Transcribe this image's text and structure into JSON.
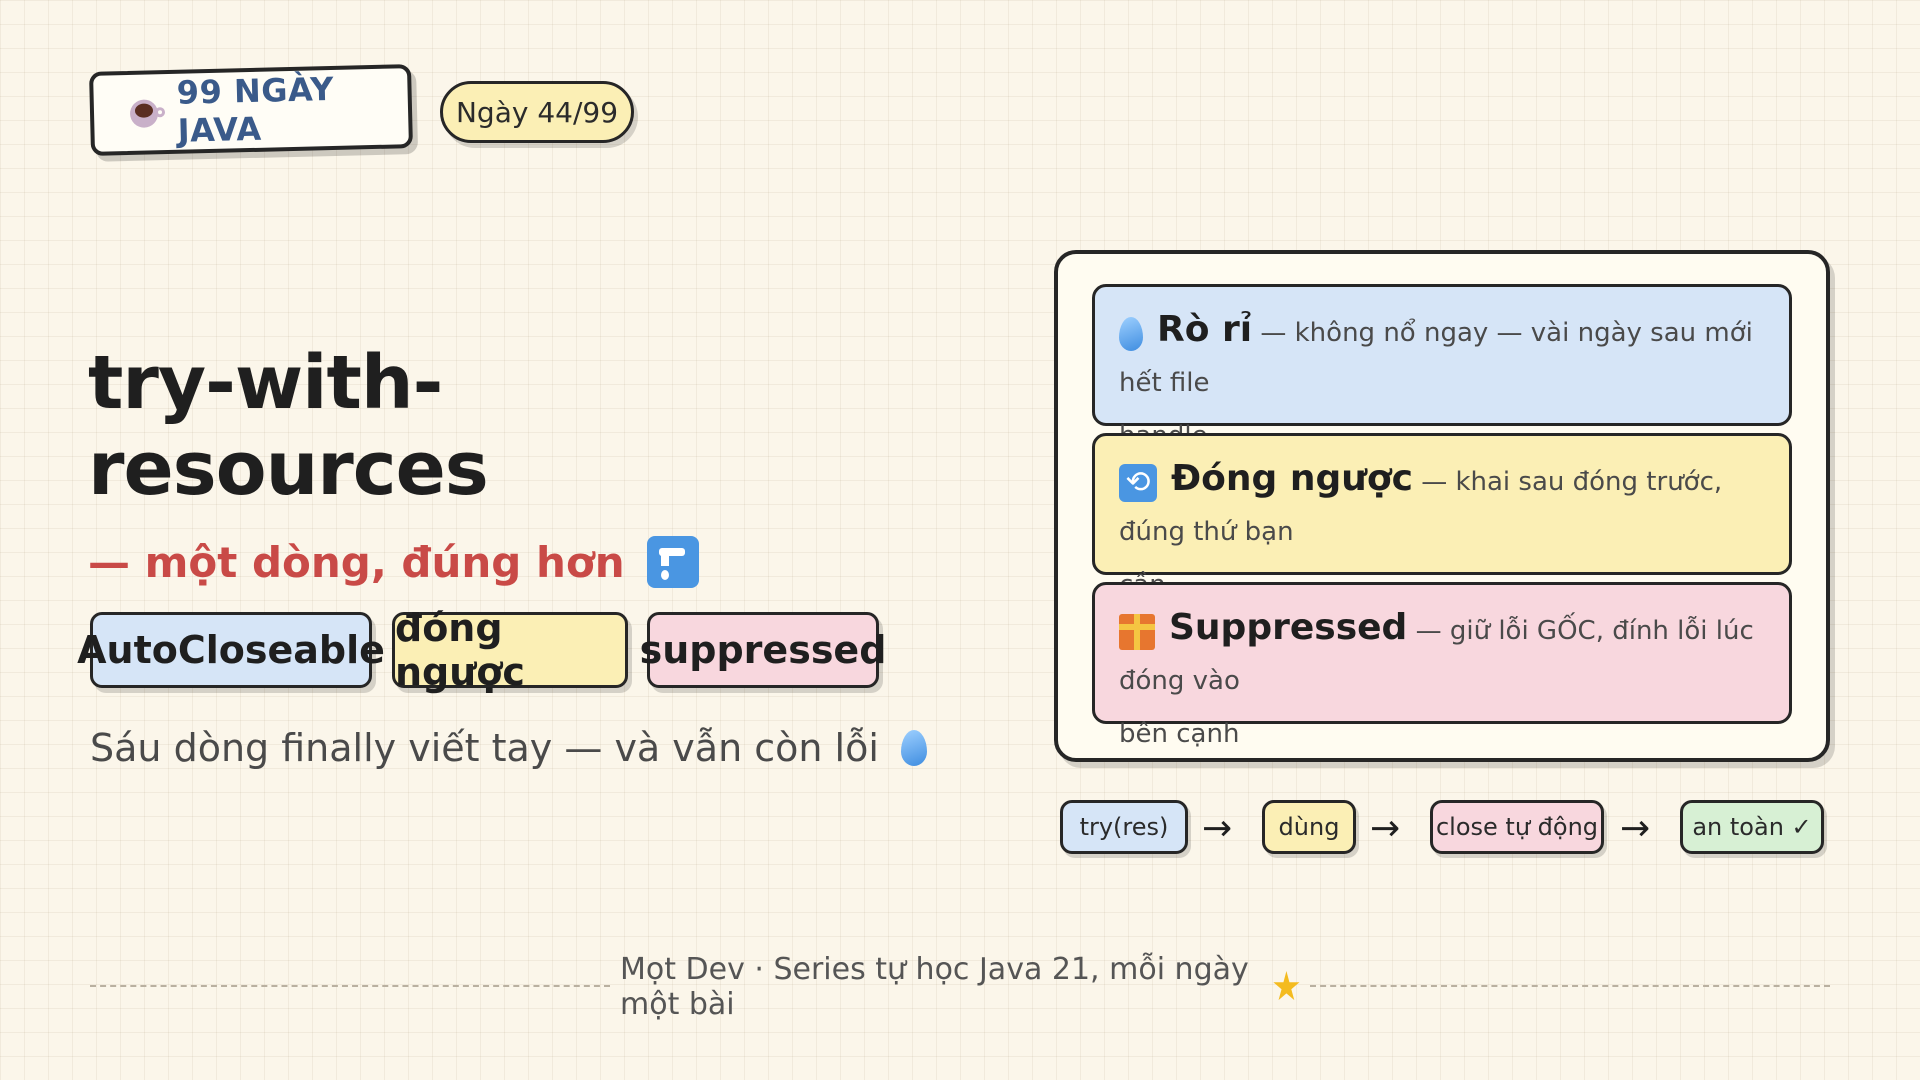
{
  "header": {
    "series_label": "99 NGÀY JAVA",
    "day_label": "Ngày 44/99"
  },
  "hero": {
    "title_line1": "try-with-",
    "title_line2": "resources",
    "subtitle": "— một dòng, đúng hơn",
    "tags": [
      "AutoCloseable",
      "đóng ngược",
      "suppressed"
    ],
    "tagline": "Sáu dòng finally viết tay — và vẫn còn lỗi"
  },
  "cards": [
    {
      "icon": "droplet-icon",
      "head": "Rò rỉ",
      "text": "— không nổ ngay — vài ngày sau mới hết file",
      "text2": "handle",
      "color": "#d6e5f7"
    },
    {
      "icon": "reverse-arrows-icon",
      "head": "Đóng ngược",
      "text": "— khai sau đóng trước, đúng thứ bạn",
      "text2": "cần",
      "color": "#fbefb5"
    },
    {
      "icon": "gift-icon",
      "head": "Suppressed",
      "text": "— giữ lỗi GỐC, đính lỗi lúc đóng vào",
      "text2": "bên cạnh",
      "color": "#f8d7de"
    }
  ],
  "flow": {
    "steps": [
      "try(res)",
      "dùng",
      "close tự động",
      "an toàn ✓"
    ],
    "arrow": "→"
  },
  "footer": {
    "text": "Mọt Dev · Series tự học Java 21, mỗi ngày một bài"
  },
  "colors": {
    "background": "#fbf6ea",
    "blue": "#d6e5f7",
    "yellow": "#fbefb5",
    "pink": "#f8d7de",
    "green": "#d7f0d4",
    "accent_red": "#c94a47",
    "series_blue": "#3a5a8a"
  }
}
